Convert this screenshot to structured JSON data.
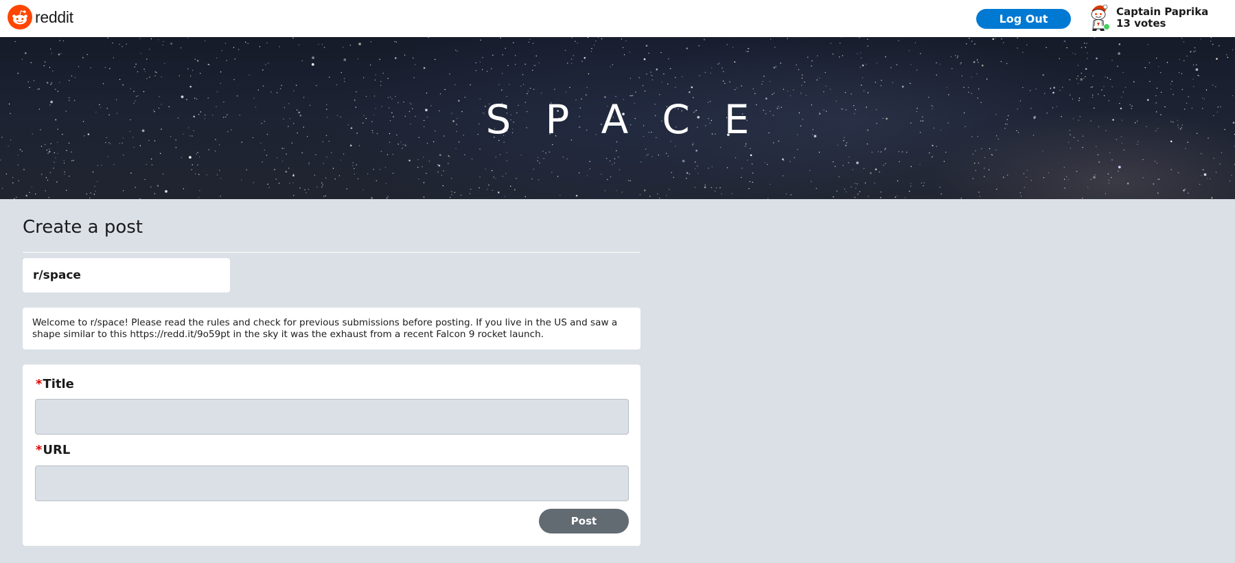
{
  "header": {
    "logo_text": "reddit",
    "logout_label": "Log Out",
    "user": {
      "name": "Captain Paprika",
      "karma": "13 votes"
    }
  },
  "banner": {
    "title": "SPACE"
  },
  "page": {
    "title": "Create a post"
  },
  "community": {
    "name": "r/space"
  },
  "rules": {
    "text": "Welcome to r/space! Please read the rules and check for previous submissions before posting. If you live in the US and saw a shape similar to this https://redd.it/9o59pt in the sky it was the exhaust from a recent Falcon 9 rocket launch."
  },
  "form": {
    "required_marker": "*",
    "title_label": "Title",
    "title_value": "",
    "url_label": "URL",
    "url_value": "",
    "post_label": "Post"
  },
  "colors": {
    "brand": "#ff4500",
    "primary_button": "#0079d3",
    "post_button": "#626a72",
    "page_background": "#dae0e6",
    "required": "#e00000",
    "online": "#46d160"
  }
}
